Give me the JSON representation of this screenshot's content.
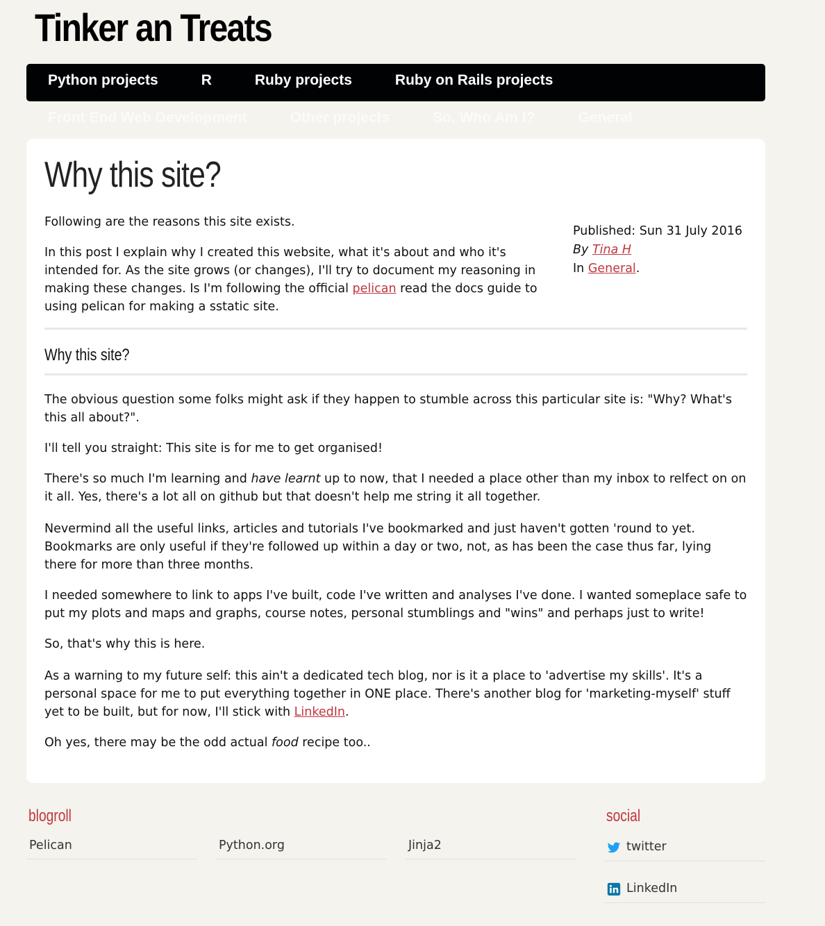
{
  "site": {
    "title": "Tinker an Treats"
  },
  "nav": {
    "row1": [
      "Python projects",
      "R",
      "Ruby projects",
      "Ruby on Rails projects"
    ],
    "row2": [
      "Front End Web Development",
      "Other projects",
      "So, Who Am I?",
      "General"
    ]
  },
  "article": {
    "title": "Why this site?",
    "intro": "Following are the reasons this site exists.",
    "summary_before_link": "In this post I explain why I created this website, what it's about and who it's intended for. As the site grows (or changes), I'll try to document my reasoning in making these changes. Is I'm following the official ",
    "summary_link": "pelican",
    "summary_after_link": " read the docs guide to using pelican for making a sstatic site.",
    "meta": {
      "published": "Published: Sun 31 July 2016",
      "by_prefix": "By ",
      "author": "Tina H",
      "in_prefix": "In ",
      "category": "General",
      "in_suffix": "."
    },
    "section_heading": "Why this site?",
    "p1": "The obvious question some folks might ask if they happen to stumble across this particular site is: \"Why? What's this all about?\".",
    "p2": "I'll tell you straight: This site is for me to get organised!",
    "p3_before": "There's so much I'm learning and ",
    "p3_em": "have learnt",
    "p3_after": " up to now, that I needed a place other than my inbox to relfect on on it all. Yes, there's a lot all on github but that doesn't help me string it all together.",
    "p4": "Nevermind all the useful links, articles and tutorials I've bookmarked and just haven't gotten 'round to yet. Bookmarks are only useful if they're followed up within a day or two, not, as has been the case thus far, lying there for more than three months.",
    "p5": "I needed somewhere to link to apps I've built, code I've written and analyses I've done. I wanted someplace safe to put my plots and maps and graphs, course notes, personal stumblings and \"wins\" and perhaps just to write!",
    "p6": "So, that's why this is here.",
    "p7_before": "As a warning to my future self: this ain't a dedicated tech blog, nor is it a place to 'advertise my skills'. It's a personal space for me to put everything together in ONE place. There's another blog for 'marketing-myself' stuff yet to be built, but for now, I'll stick with ",
    "p7_link": "LinkedIn",
    "p7_after": ".",
    "p8_before": "Oh yes, there may be the odd actual ",
    "p8_em": "food",
    "p8_after": " recipe too.."
  },
  "footer": {
    "blogroll_heading": "blogroll",
    "blogroll": [
      "Pelican",
      "Python.org",
      "Jinja2"
    ],
    "social_heading": "social",
    "social": [
      {
        "label": "twitter",
        "icon": "twitter-icon"
      },
      {
        "label": "LinkedIn",
        "icon": "linkedin-icon"
      }
    ]
  },
  "colors": {
    "accent": "#c1363f",
    "navbar": "#010203",
    "background": "#f4f3ee"
  }
}
